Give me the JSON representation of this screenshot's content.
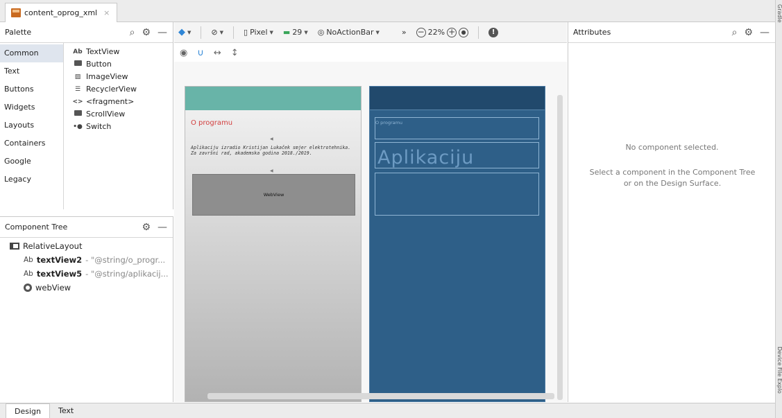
{
  "file_tab": {
    "label": "content_oprog_xml",
    "close": "×"
  },
  "palette": {
    "title": "Palette",
    "categories": [
      "Common",
      "Text",
      "Buttons",
      "Widgets",
      "Layouts",
      "Containers",
      "Google",
      "Legacy"
    ],
    "widgets": [
      {
        "icon": "Ab",
        "label": "TextView"
      },
      {
        "icon": "button-icon",
        "label": "Button"
      },
      {
        "icon": "image-icon",
        "label": "ImageView"
      },
      {
        "icon": "list-icon",
        "label": "RecyclerView"
      },
      {
        "icon": "<>",
        "label": "<fragment>"
      },
      {
        "icon": "scroll-icon",
        "label": "ScrollView"
      },
      {
        "icon": "switch-icon",
        "label": "Switch"
      }
    ]
  },
  "component_tree": {
    "title": "Component Tree",
    "root": "RelativeLayout",
    "children": [
      {
        "type": "Ab",
        "name": "textView2",
        "value": "- \"@string/o_progr..."
      },
      {
        "type": "Ab",
        "name": "textView5",
        "value": "- \"@string/aplikacij..."
      },
      {
        "type": "globe-icon",
        "name": "webView",
        "value": ""
      }
    ]
  },
  "toolbar": {
    "device": "Pixel",
    "api": "29",
    "theme": "NoActionBar",
    "overflow": "»",
    "zoom": "22%",
    "zoom_out": "−",
    "zoom_in": "+"
  },
  "design": {
    "text1": "O programu",
    "text2": "Aplikaciju izradio Kristijan Lukaček smjer elektrotehnika. Za završni rad, akademska godina 2018./2019.",
    "webview": "WebView"
  },
  "blueprint": {
    "text1": "O programu",
    "big": "Aplikaciju"
  },
  "attributes": {
    "title": "Attributes",
    "empty": "No component selected.",
    "hint": "Select a component in the Component Tree or on the Design Surface."
  },
  "right_strip": {
    "top": "Gradle",
    "bottom": "Device File Explo"
  },
  "bottom_tabs": [
    "Design",
    "Text"
  ]
}
